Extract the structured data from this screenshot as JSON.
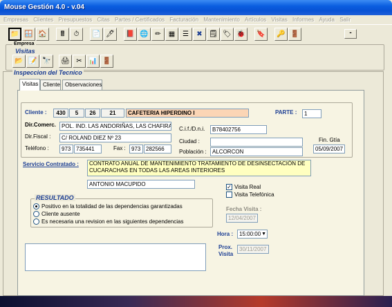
{
  "window": {
    "title": "Mouse Gestión 4.0  - v.04"
  },
  "menu": [
    "Empresas",
    "Clientes",
    "Presupuestos",
    "Citas",
    "Partes / Certificados",
    "Facturación",
    "Mantenimiento",
    "Artículos",
    "Visitas",
    "Informes",
    "Ayuda",
    "Salir"
  ],
  "groups": {
    "empresa": "Empresa",
    "visitas": "Visitas",
    "inspeccion": "Inspeccion del Tecnico"
  },
  "tabs": [
    "Visitas",
    "Cliente",
    "Observaciones"
  ],
  "form": {
    "cliente_label": "Cliente :",
    "cliente_codes": [
      "430",
      "5",
      "26",
      "21"
    ],
    "cliente_name": "CAFETERIA HIPERDINO I",
    "parte_label": "PARTE :",
    "parte_value": "1",
    "dircomerc_label": "Dir.Comerc.",
    "dircomerc_value": "POL. IND. LAS ANDORIÑAS, LAS CHAFIRAS",
    "cif_label": "C.i.f./D.n.i.",
    "cif_value": "B78402756",
    "dirfiscal_label": "Dir.Fiscal :",
    "dirfiscal_value": "C/ ROLAND DIEZ Nº 23",
    "ciudad_label": "Ciudad :",
    "ciudad_value": "",
    "fingtia_label": "Fin. Gtía",
    "fingtia_value": "05/09/2007",
    "telefono_label": "Teléfono :",
    "tel_prefix": "973",
    "tel_number": "735441",
    "fax_label": "Fax :",
    "fax_prefix": "973",
    "fax_number": "282566",
    "poblacion_label": "Población :",
    "poblacion_value": "ALCORCON",
    "servicio_label": "Servicio Contratado :",
    "servicio_value": "CONTRATO ANUAL DE MANTENIMIENTO TRATAMIENTO DE DESINSECTACIÓN DE CUCARACHAS EN TODAS LAS AREAS INTERIORES",
    "tecnico_value": "ANTONIO MACUPIDO",
    "visita_real_label": "Visita Real",
    "visita_real_checked": "✓",
    "visita_tel_label": "Visita Telefónica",
    "resultado_label": "RESULTADO",
    "resultado_options": [
      "Positivo en la totalidad de las dependencias garantizadas",
      "Cliente ausente",
      "Es necesaria una revision en las siguientes dependencias"
    ],
    "fecha_visita_label": "Fecha Visita :",
    "fecha_visita_value": "12/04/2007",
    "hora_label": "Hora :",
    "hora_value": "15:00:00",
    "prox_visita_label": "Prox. Visita",
    "prox_visita_value": "30/11/2007",
    "observaciones": ""
  },
  "icons": {
    "toolbar1": [
      "folder-icon",
      "window-icon",
      "home-icon",
      "calculator-icon",
      "clock-icon",
      "document-icon",
      "pen-icon",
      "book-icon",
      "globe-icon",
      "pencil-icon",
      "grid-icon",
      "list-icon",
      "close-x-icon",
      "notes-icon",
      "stamp-icon",
      "bug-icon",
      "label-icon",
      "key-icon",
      "exit-icon"
    ],
    "toolbar2": [
      "folder-icon",
      "edit-icon",
      "binoculars-icon",
      "print-icon",
      "cut-icon",
      "chart-icon",
      "exit-icon"
    ]
  }
}
